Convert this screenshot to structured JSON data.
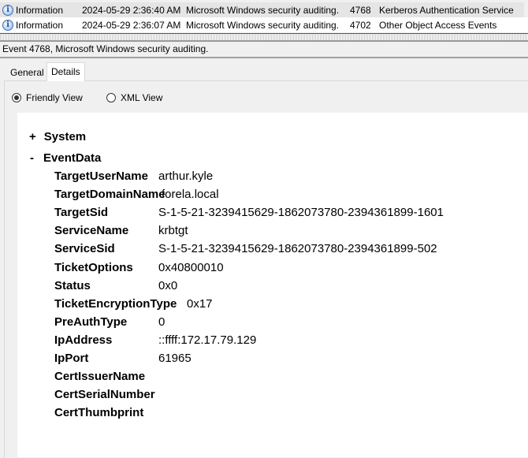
{
  "events": [
    {
      "level": "Information",
      "date": "2024-05-29 2:36:40 AM",
      "source": "Microsoft Windows security auditing.",
      "id": "4768",
      "task": "Kerberos Authentication Service"
    },
    {
      "level": "Information",
      "date": "2024-05-29 2:36:07 AM",
      "source": "Microsoft Windows security auditing.",
      "id": "4702",
      "task": "Other Object Access Events"
    }
  ],
  "title": "Event 4768, Microsoft Windows security auditing.",
  "tabs": [
    "General",
    "Details"
  ],
  "views": [
    "Friendly View",
    "XML View"
  ],
  "tree": {
    "system": {
      "toggle": "+",
      "label": "System"
    },
    "eventdata": {
      "toggle": "-",
      "label": "EventData"
    }
  },
  "fields": [
    {
      "k": "TargetUserName",
      "v": "arthur.kyle"
    },
    {
      "k": "TargetDomainName",
      "v": "forela.local"
    },
    {
      "k": "TargetSid",
      "v": "S-1-5-21-3239415629-1862073780-2394361899-1601"
    },
    {
      "k": "ServiceName",
      "v": "krbtgt"
    },
    {
      "k": "ServiceSid",
      "v": "S-1-5-21-3239415629-1862073780-2394361899-502"
    },
    {
      "k": "TicketOptions",
      "v": "0x40800010"
    },
    {
      "k": "Status",
      "v": "0x0"
    },
    {
      "k": "TicketEncryptionType",
      "v": "0x17"
    },
    {
      "k": "PreAuthType",
      "v": "0"
    },
    {
      "k": "IpAddress",
      "v": "::ffff:172.17.79.129"
    },
    {
      "k": "IpPort",
      "v": "61965"
    },
    {
      "k": "CertIssuerName",
      "v": ""
    },
    {
      "k": "CertSerialNumber",
      "v": ""
    },
    {
      "k": "CertThumbprint",
      "v": ""
    }
  ]
}
